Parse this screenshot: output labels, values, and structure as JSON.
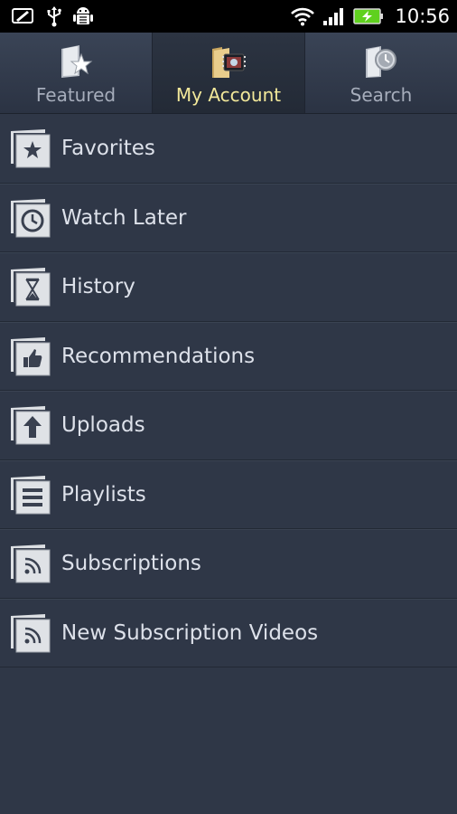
{
  "status_bar": {
    "time": "10:56",
    "icons": [
      "screenshot-icon",
      "usb-icon",
      "android-debug-icon",
      "wifi-icon",
      "signal-icon",
      "battery-charging-icon"
    ]
  },
  "tabs": [
    {
      "label": "Featured",
      "icon": "featured-star-icon",
      "active": false
    },
    {
      "label": "My Account",
      "icon": "my-account-folder-icon",
      "active": true
    },
    {
      "label": "Search",
      "icon": "search-clock-icon",
      "active": false
    }
  ],
  "menu": [
    {
      "label": "Favorites",
      "icon": "star-icon"
    },
    {
      "label": "Watch Later",
      "icon": "clock-icon"
    },
    {
      "label": "History",
      "icon": "hourglass-icon"
    },
    {
      "label": "Recommendations",
      "icon": "thumbs-up-icon"
    },
    {
      "label": "Uploads",
      "icon": "upload-arrow-icon"
    },
    {
      "label": "Playlists",
      "icon": "list-icon"
    },
    {
      "label": "Subscriptions",
      "icon": "rss-icon"
    },
    {
      "label": "New Subscription Videos",
      "icon": "rss-icon"
    }
  ],
  "colors": {
    "background": "#2f3747",
    "active_tab_label": "#f2e89a",
    "inactive_tab_label": "#a6adbb",
    "item_text": "#dde1ea"
  }
}
